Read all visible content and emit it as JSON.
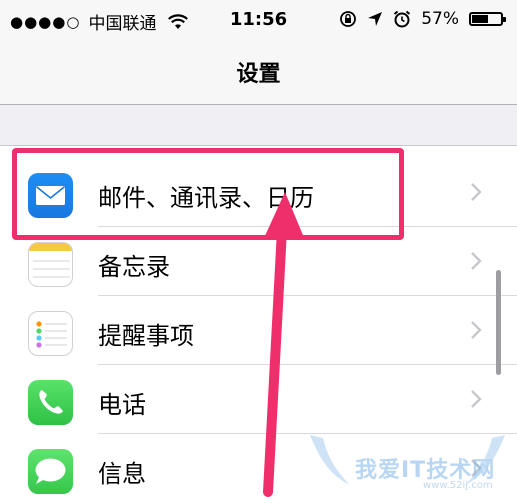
{
  "status_bar": {
    "signal": "●●●●○",
    "carrier": "中国联通",
    "time": "11:56",
    "battery_percent": "57%",
    "battery_level": 0.57,
    "icons": [
      "wifi-icon",
      "orientation-lock-icon",
      "location-arrow-icon",
      "alarm-icon",
      "battery-icon"
    ]
  },
  "nav": {
    "title": "设置"
  },
  "rows": [
    {
      "label": "邮件、通讯录、日历",
      "icon": "mail-icon"
    },
    {
      "label": "备忘录",
      "icon": "notes-icon"
    },
    {
      "label": "提醒事项",
      "icon": "reminders-icon"
    },
    {
      "label": "电话",
      "icon": "phone-icon"
    },
    {
      "label": "信息",
      "icon": "messages-icon"
    }
  ],
  "annotation": {
    "color": "#ee2f6c"
  },
  "watermark": {
    "text": "我爱IT技术网",
    "url": "www.52ij.com"
  },
  "colors": {
    "background": "#efeff4",
    "separator": "#d9d9de",
    "chevron": "#c7c7cc"
  }
}
